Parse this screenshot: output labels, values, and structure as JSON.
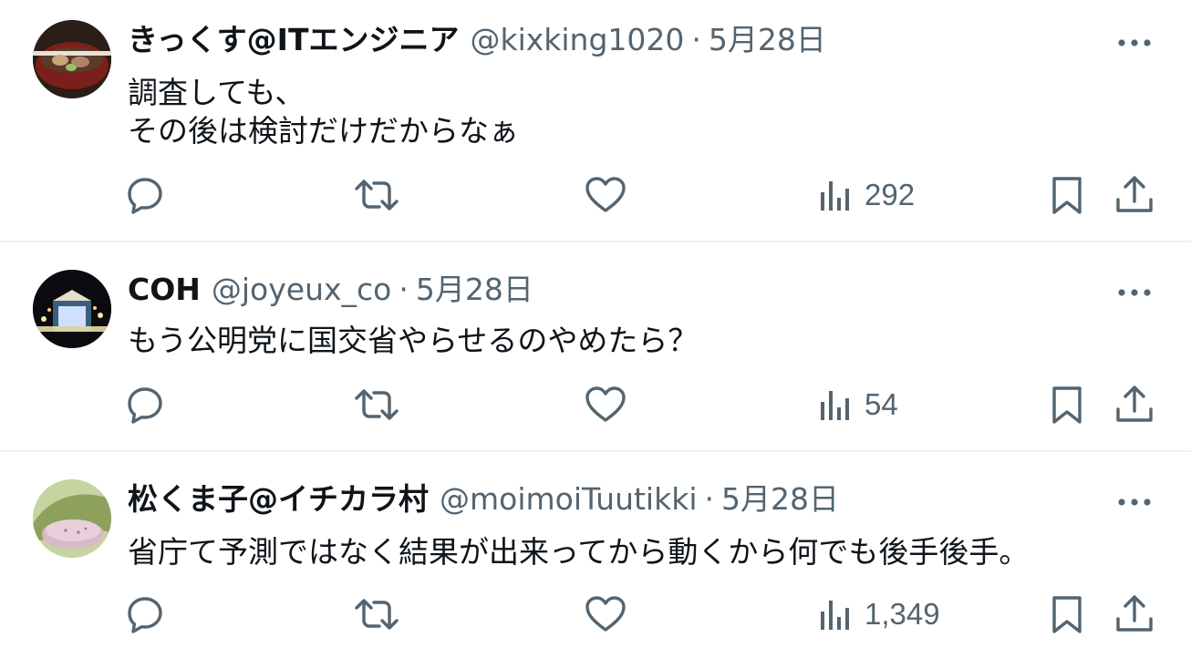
{
  "tweets": [
    {
      "name": "きっくす@ITエンジニア",
      "handle": "@kixking1020",
      "separator": "·",
      "date": "5月28日",
      "text_lines": [
        "調査しても、",
        "その後は検討だけだからなぁ"
      ],
      "views": "292"
    },
    {
      "name": "COH",
      "handle": "@joyeux_co",
      "separator": "·",
      "date": "5月28日",
      "text_lines": [
        "もう公明党に国交省やらせるのやめたら？"
      ],
      "views": "54"
    },
    {
      "name": "松くま子@イチカラ村",
      "handle": "@moimoiTuutikki",
      "separator": "·",
      "date": "5月28日",
      "text_lines": [
        "省庁て予測ではなく結果が出来ってから動くから何でも後手後手。"
      ],
      "views": "1,349"
    }
  ],
  "icons": {
    "reply": "reply-icon",
    "retweet": "retweet-icon",
    "like": "like-icon",
    "views": "views-icon",
    "bookmark": "bookmark-icon",
    "share": "share-icon",
    "more": "more-icon"
  },
  "colors": {
    "text": "#0f1419",
    "secondary": "#536471",
    "divider": "#eff3f4"
  }
}
